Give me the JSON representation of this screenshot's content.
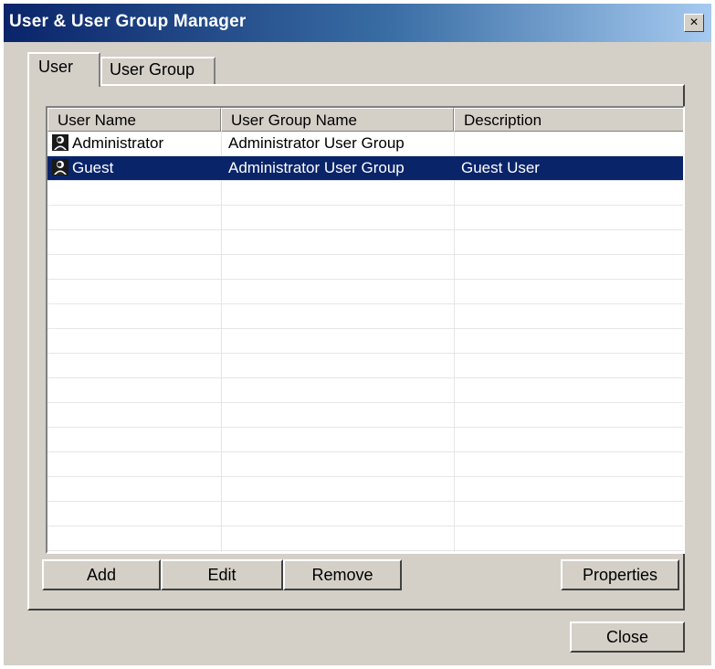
{
  "window": {
    "title": "User & User Group Manager",
    "close_glyph": "×"
  },
  "tabs": [
    {
      "label": "User",
      "active": true
    },
    {
      "label": "User Group",
      "active": false
    }
  ],
  "table": {
    "columns": [
      "User Name",
      "User Group Name",
      "Description"
    ],
    "rows": [
      {
        "name": "Administrator",
        "group": "Administrator User Group",
        "description": "",
        "icon": "user-icon",
        "selected": false
      },
      {
        "name": "Guest",
        "group": "Administrator User Group",
        "description": "Guest User",
        "icon": "user-icon",
        "selected": true
      }
    ],
    "empty_rows": 15
  },
  "buttons": {
    "add": "Add",
    "edit": "Edit",
    "remove": "Remove",
    "properties": "Properties",
    "close": "Close"
  },
  "colors": {
    "selection": "#0a246a",
    "face": "#d4d0c8",
    "title_start": "#0a246a",
    "title_end": "#a6caf0"
  }
}
